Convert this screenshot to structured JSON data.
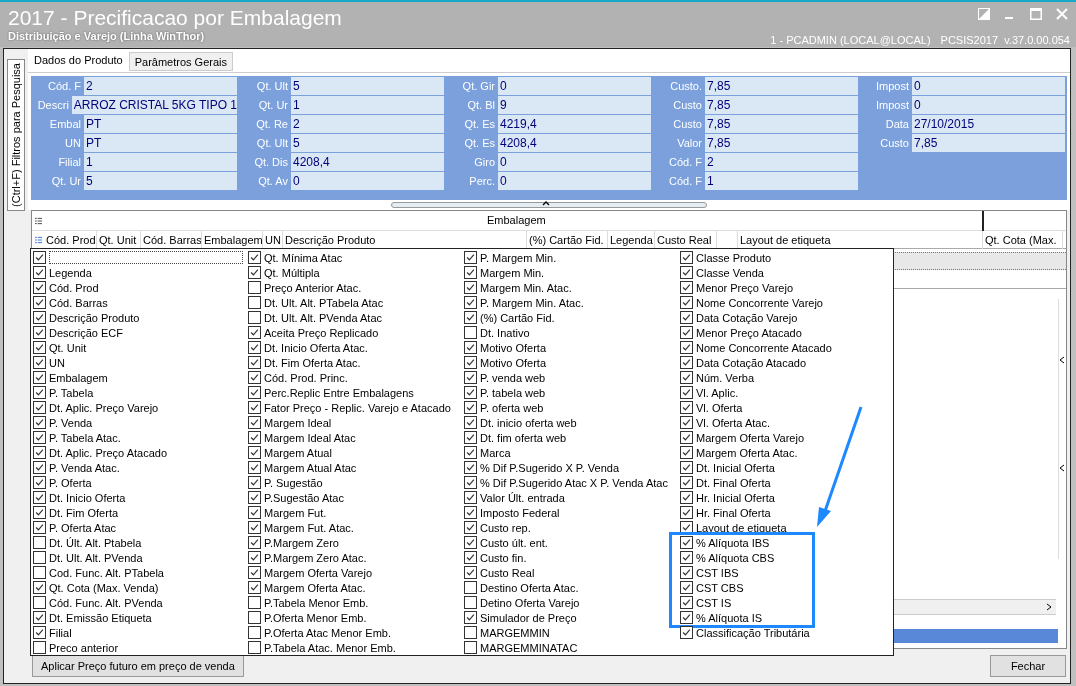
{
  "window": {
    "title": "2017 - Precificacao por Embalagem",
    "subtitle": "Distribuição e Varejo (Linha WinThor)",
    "session": "1 - PCADMIN (LOCAL@LOCAL)",
    "version": "PCSIS2017  v.37.0.00.054"
  },
  "side_tab": "(Ctrl+F) Filtros para Pesquisa",
  "tabs": [
    {
      "label": "Dados do Produto",
      "selected": true
    },
    {
      "label": "Parâmetros Gerais",
      "selected": false
    }
  ],
  "info_groups": [
    [
      {
        "label": "Cód. F",
        "value": "2"
      },
      {
        "label": "Descri",
        "value": "ARROZ CRISTAL 5KG TIPO 1"
      },
      {
        "label": "Embal",
        "value": "PT"
      },
      {
        "label": "UN",
        "value": "PT"
      },
      {
        "label": "Filial",
        "value": "1"
      },
      {
        "label": "Qt. Ur",
        "value": "5"
      }
    ],
    [
      {
        "label": "Qt. Ult",
        "value": "5"
      },
      {
        "label": "Qt. Ur",
        "value": "1"
      },
      {
        "label": "Qt. Re",
        "value": "2"
      },
      {
        "label": "Qt. Ult",
        "value": "5"
      },
      {
        "label": "Qt. Dis",
        "value": "4208,4"
      },
      {
        "label": "Qt. Av",
        "value": "0"
      }
    ],
    [
      {
        "label": "Qt. Gir",
        "value": "0"
      },
      {
        "label": "Qt. Bl",
        "value": "9"
      },
      {
        "label": "Qt. Es",
        "value": "4219,4"
      },
      {
        "label": "Qt. Es",
        "value": "4208,4"
      },
      {
        "label": "Giro",
        "value": "0"
      },
      {
        "label": "Perc.",
        "value": "0"
      }
    ],
    [
      {
        "label": "Custo.",
        "value": "7,85"
      },
      {
        "label": "Custo",
        "value": "7,85"
      },
      {
        "label": "Custo",
        "value": "7,85"
      },
      {
        "label": "Valor",
        "value": "7,85"
      },
      {
        "label": "Cód. F",
        "value": "2"
      },
      {
        "label": "Cód. F",
        "value": "1"
      }
    ],
    [
      {
        "label": "Impost",
        "value": "0"
      },
      {
        "label": "Impost",
        "value": "0"
      },
      {
        "label": "Data",
        "value": "27/10/2015"
      },
      {
        "label": "Custo",
        "value": "7,85"
      }
    ]
  ],
  "grid": {
    "group_header": "Embalagem",
    "columns": [
      "Cód. Prod",
      "Qt. Unit",
      "Cód. Barras",
      "Embalagem",
      "UN",
      "Descrição Produto",
      "(%) Cartão Fid.",
      "Legenda",
      "Custo Real",
      "",
      "Layout de etiqueta",
      "Qt. Cota (Max."
    ]
  },
  "column_chooser": [
    [
      {
        "checked": true,
        "focused": true
      },
      {
        "label": "Legenda",
        "checked": true
      },
      {
        "label": "Cód. Prod",
        "checked": true
      },
      {
        "label": "Cód. Barras",
        "checked": true
      },
      {
        "label": "Descrição Produto",
        "checked": true
      },
      {
        "label": "Descrição ECF",
        "checked": true
      },
      {
        "label": "Qt. Unit",
        "checked": true
      },
      {
        "label": "UN",
        "checked": true
      },
      {
        "label": "Embalagem",
        "checked": true
      },
      {
        "label": "P. Tabela",
        "checked": true
      },
      {
        "label": "Dt. Aplic. Preço Varejo",
        "checked": true
      },
      {
        "label": "P. Venda",
        "checked": true
      },
      {
        "label": "P. Tabela Atac.",
        "checked": true
      },
      {
        "label": "Dt. Aplic. Preço Atacado",
        "checked": true
      },
      {
        "label": "P. Venda Atac.",
        "checked": true
      },
      {
        "label": "P. Oferta",
        "checked": true
      },
      {
        "label": "Dt. Inicio Oferta",
        "checked": true
      },
      {
        "label": "Dt. Fim Oferta",
        "checked": true
      },
      {
        "label": "P. Oferta Atac",
        "checked": true
      },
      {
        "label": "Dt. Últ. Alt. Ptabela",
        "checked": false
      },
      {
        "label": "Dt. Ult. Alt. PVenda",
        "checked": false
      },
      {
        "label": "Cod. Func. Alt. PTabela",
        "checked": false
      },
      {
        "label": "Qt. Cota (Max. Venda)",
        "checked": true
      },
      {
        "label": "Cód. Func. Alt. PVenda",
        "checked": false
      },
      {
        "label": "Dt. Emissão Etiqueta",
        "checked": true
      },
      {
        "label": "Filial",
        "checked": true
      },
      {
        "label": "Preco anterior",
        "checked": false
      }
    ],
    [
      {
        "label": "Qt. Mínima Atac",
        "checked": true
      },
      {
        "label": "Qt. Múltipla",
        "checked": true
      },
      {
        "label": "Preço Anterior Atac.",
        "checked": false
      },
      {
        "label": "Dt. Ult. Alt. PTabela Atac",
        "checked": false
      },
      {
        "label": "Dt. Ult. Alt. PVenda Atac",
        "checked": false
      },
      {
        "label": "Aceita Preço Replicado",
        "checked": true
      },
      {
        "label": "Dt. Inicio Oferta Atac.",
        "checked": true
      },
      {
        "label": "Dt. Fim Oferta Atac.",
        "checked": true
      },
      {
        "label": "Cód. Prod. Princ.",
        "checked": true
      },
      {
        "label": "Perc.Replic Entre Embalagens",
        "checked": true
      },
      {
        "label": "Fator Preço - Replic. Varejo e Atacado",
        "checked": true
      },
      {
        "label": "Margem Ideal",
        "checked": true
      },
      {
        "label": "Margem Ideal Atac",
        "checked": true
      },
      {
        "label": "Margem Atual",
        "checked": true
      },
      {
        "label": "Margem Atual Atac",
        "checked": true
      },
      {
        "label": "P. Sugestão",
        "checked": true
      },
      {
        "label": "P.Sugestão Atac",
        "checked": true
      },
      {
        "label": "Margem Fut.",
        "checked": true
      },
      {
        "label": "Margem Fut. Atac.",
        "checked": true
      },
      {
        "label": "P.Margem Zero",
        "checked": true
      },
      {
        "label": "P.Margem Zero Atac.",
        "checked": true
      },
      {
        "label": "Margem Oferta Varejo",
        "checked": true
      },
      {
        "label": "Margem Oferta Atac.",
        "checked": true
      },
      {
        "label": "P.Tabela Menor Emb.",
        "checked": false
      },
      {
        "label": "P.Oferta Menor Emb.",
        "checked": false
      },
      {
        "label": "P.Oferta Atac Menor Emb.",
        "checked": false
      },
      {
        "label": "P.Tabela Atac. Menor Emb.",
        "checked": false
      }
    ],
    [
      {
        "label": "P. Margem Min.",
        "checked": true
      },
      {
        "label": "Margem Min.",
        "checked": true
      },
      {
        "label": "Margem Min. Atac.",
        "checked": true
      },
      {
        "label": "P. Margem Min. Atac.",
        "checked": true
      },
      {
        "label": "(%) Cartão Fid.",
        "checked": true
      },
      {
        "label": "Dt. Inativo",
        "checked": false
      },
      {
        "label": "Motivo Oferta",
        "checked": true
      },
      {
        "label": "Motivo Oferta",
        "checked": true
      },
      {
        "label": "P. venda web",
        "checked": true
      },
      {
        "label": "P. tabela web",
        "checked": true
      },
      {
        "label": "P. oferta web",
        "checked": true
      },
      {
        "label": "Dt. inicio oferta web",
        "checked": true
      },
      {
        "label": "Dt. fim oferta web",
        "checked": true
      },
      {
        "label": "Marca",
        "checked": true
      },
      {
        "label": "% Dif P.Sugerido X P. Venda",
        "checked": true
      },
      {
        "label": "% Dif P.Sugerido Atac X P. Venda Atac",
        "checked": true
      },
      {
        "label": "Valor Últ. entrada",
        "checked": true
      },
      {
        "label": "Imposto Federal",
        "checked": true
      },
      {
        "label": "Custo rep.",
        "checked": true
      },
      {
        "label": "Custo últ. ent.",
        "checked": true
      },
      {
        "label": "Custo fin.",
        "checked": true
      },
      {
        "label": "Custo Real",
        "checked": true
      },
      {
        "label": "Destino Oferta Atac.",
        "checked": false
      },
      {
        "label": "Detino Oferta Varejo",
        "checked": false
      },
      {
        "label": "Simulador de Preço",
        "checked": true
      },
      {
        "label": "MARGEMMIN",
        "checked": false
      },
      {
        "label": "MARGEMMINATAC",
        "checked": false
      }
    ],
    [
      {
        "label": "Classe Produto",
        "checked": true
      },
      {
        "label": "Classe Venda",
        "checked": true
      },
      {
        "label": "Menor Preço Varejo",
        "checked": true
      },
      {
        "label": "Nome Concorrente Varejo",
        "checked": true
      },
      {
        "label": "Data Cotação Varejo",
        "checked": true
      },
      {
        "label": "Menor Preço Atacado",
        "checked": true
      },
      {
        "label": "Nome Concorrente Atacado",
        "checked": true
      },
      {
        "label": "Data Cotação Atacado",
        "checked": true
      },
      {
        "label": "Núm. Verba",
        "checked": true
      },
      {
        "label": "Vl. Aplic.",
        "checked": true
      },
      {
        "label": "Vl. Oferta",
        "checked": true
      },
      {
        "label": "Vl. Oferta Atac.",
        "checked": true
      },
      {
        "label": "Margem Oferta Varejo",
        "checked": true
      },
      {
        "label": "Margem Oferta Atac.",
        "checked": true
      },
      {
        "label": "Dt. Inicial Oferta",
        "checked": true
      },
      {
        "label": "Dt. Final Oferta",
        "checked": true
      },
      {
        "label": "Hr. Inicial Oferta",
        "checked": true
      },
      {
        "label": "Hr. Final Oferta",
        "checked": true
      },
      {
        "label": "Layout de etiqueta",
        "checked": true
      },
      {
        "label": "% Alíquota IBS",
        "checked": true,
        "highlighted": true
      },
      {
        "label": "% Alíquota CBS",
        "checked": true,
        "highlighted": true
      },
      {
        "label": "CST IBS",
        "checked": true,
        "highlighted": true
      },
      {
        "label": "CST CBS",
        "checked": true,
        "highlighted": true
      },
      {
        "label": "CST IS",
        "checked": true,
        "highlighted": true
      },
      {
        "label": "% Alíquota IS",
        "checked": true,
        "highlighted": true
      },
      {
        "label": "Classificação Tributária",
        "checked": true
      }
    ]
  ],
  "buttons": {
    "left": "Aplicar Preço futuro em preço de venda",
    "right": "Fechar"
  }
}
